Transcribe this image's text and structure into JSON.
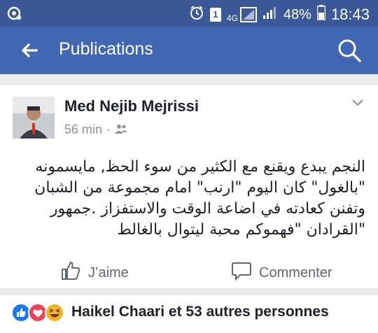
{
  "status_bar": {
    "sim_indicator": "1",
    "network": "4G",
    "battery": "48%",
    "time": "18:43"
  },
  "header": {
    "title": "Publications",
    "back_icon": "back-arrow-icon",
    "search_icon": "search-icon"
  },
  "post": {
    "author": "Med Nejib Mejrissi",
    "time": "56 min",
    "audience_icon": "friends-icon",
    "text_lines": [
      "النجم يبدع ويقنع مع الكثير من سوء الحظ, مايسمونه",
      "\"بالغول\" كان اليوم \"ارنب\" امام مجموعة من الشبان",
      "وتفنن كعادته في اضاعة الوقت والاستفزاز .جمهور",
      "\"القرادان \"فهموكم محبة ليتوال بالغالط"
    ],
    "actions": {
      "like_label": "J’aime",
      "comment_label": "Commenter"
    }
  },
  "reactions": {
    "summary": "Haikel Chaari et 53 autres personnes",
    "types": [
      "like",
      "love",
      "haha"
    ],
    "colors": {
      "like": "#1877f2",
      "love": "#f33e58",
      "haha": "#f7b125"
    }
  },
  "theme": {
    "status_bar_bg": "#3b5998",
    "app_bar_bg": "#4267b2",
    "page_bg": "#e9ebee"
  }
}
